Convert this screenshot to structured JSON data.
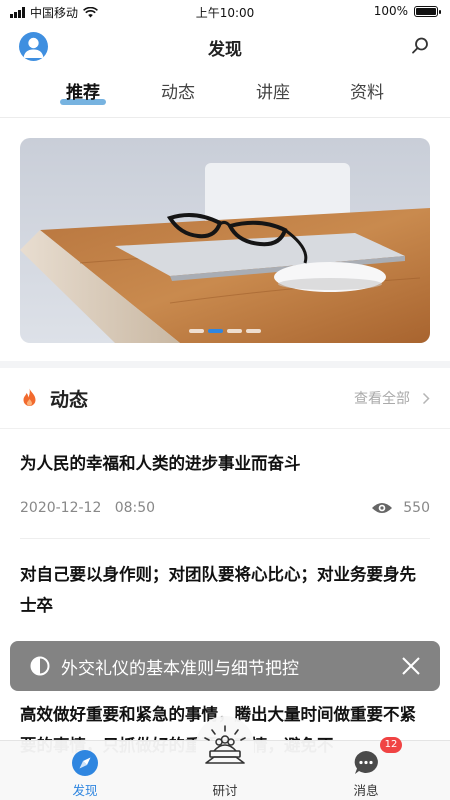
{
  "status_bar": {
    "carrier": "中国移动",
    "time": "上午10:00",
    "battery": "100%"
  },
  "header": {
    "title": "发现"
  },
  "tabs": [
    {
      "label": "推荐",
      "active": true
    },
    {
      "label": "动态",
      "active": false
    },
    {
      "label": "讲座",
      "active": false
    },
    {
      "label": "资料",
      "active": false
    }
  ],
  "banner": {
    "slide_count": 4,
    "active_slide": 2
  },
  "section": {
    "title": "动态",
    "view_all": "查看全部"
  },
  "news": [
    {
      "title": "为人民的幸福和人类的进步事业而奋斗",
      "date": "2020-12-12",
      "time": "08:50",
      "views": "550"
    },
    {
      "title": "对自己要以身作则；对团队要将心比心；对业务要身先士卒"
    },
    {
      "title": "高效做好重要和紧急的事情，腾出大量时间做重要不紧要的事情，只抓做好的重要的事情，避免不"
    }
  ],
  "toast": {
    "text": "外交礼仪的基本准则与细节把控"
  },
  "bottom_nav": [
    {
      "label": "发现",
      "icon": "compass-icon",
      "active": true
    },
    {
      "label": "研讨",
      "icon": "seminar-icon",
      "active": false
    },
    {
      "label": "消息",
      "icon": "chat-icon",
      "active": false,
      "badge": "12"
    }
  ],
  "colors": {
    "accent": "#2f86e0",
    "tab_underline": "#5fa6da",
    "badge": "#f04343",
    "fire": "#f26a2e"
  }
}
